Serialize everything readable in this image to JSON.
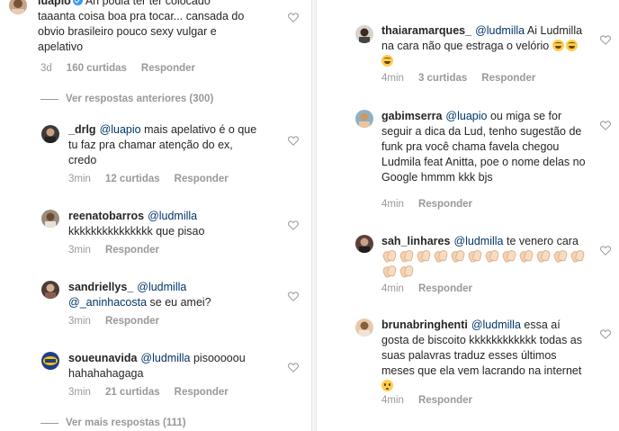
{
  "left": {
    "top_comment": {
      "username": "luapio",
      "text": "Ah podia ter ter colocado taaanta coisa boa pra tocar... cansada do obvio brasileiro pouco sexy vulgar e apelativo",
      "time": "3d",
      "likes": "160 curtidas",
      "reply": "Responder"
    },
    "view_previous": "Ver respostas anteriores (300)",
    "replies": [
      {
        "username": "_drlg",
        "mention": "@luapio",
        "text": " mais apelativo é o que tu faz pra chamar atenção do ex, credo",
        "time": "3min",
        "likes": "12 curtidas",
        "reply": "Responder"
      },
      {
        "username": "reenatobarros",
        "mention": "@ludmilla",
        "text": "kkkkkkkkkkkkkkk que pisao",
        "time": "3min",
        "likes": "",
        "reply": "Responder"
      },
      {
        "username": "sandriellys_",
        "mention": "@ludmilla",
        "mention2": "@_aninhacosta",
        "text": " se eu amei?",
        "time": "3min",
        "likes": "",
        "reply": "Responder"
      },
      {
        "username": "soueunavida",
        "mention": "@ludmilla",
        "text": " pisooooou hahahahagaga",
        "time": "3min",
        "likes": "21 curtidas",
        "reply": "Responder"
      }
    ],
    "view_more": "Ver mais respostas (111)"
  },
  "right": {
    "comments": [
      {
        "username": "thaiaramarques_",
        "mention": "@ludmilla",
        "text": " Ai Ludmilla na cara não que estraga o velório",
        "time": "4min",
        "likes": "3 curtidas",
        "reply": "Responder"
      },
      {
        "username": "gabimserra",
        "mention": "@luapio",
        "text": " ou miga se for seguir a dica da Lud, tenho sugestão de funk pra você chama favela chegou Ludmila feat Anitta, poe o nome delas no Google hmmm kkk bjs",
        "time": "4min",
        "likes": "",
        "reply": "Responder"
      },
      {
        "username": "sah_linhares",
        "mention": "@ludmilla",
        "text": " te venero cara",
        "time": "4min",
        "likes": "",
        "reply": "Responder"
      },
      {
        "username": "brunabringhenti",
        "mention": "@ludmilla",
        "text": " essa aí gosta de biscoito kkkkkkkkkkkk todas as suas palavras traduz esses últimos meses que ela vem lacrando na internet",
        "time": "4min",
        "likes": "",
        "reply": "Responder"
      }
    ]
  },
  "icons": {
    "like": "heart-outline-icon",
    "verified": "verified-badge-icon",
    "laugh_emoji": "face-with-tears-of-joy",
    "clap_emoji": "clapping-hands",
    "flushed_emoji": "flushed-face"
  },
  "colors": {
    "text": "#262626",
    "meta": "#999999",
    "mention": "#003569",
    "verified": "#3897f0"
  }
}
